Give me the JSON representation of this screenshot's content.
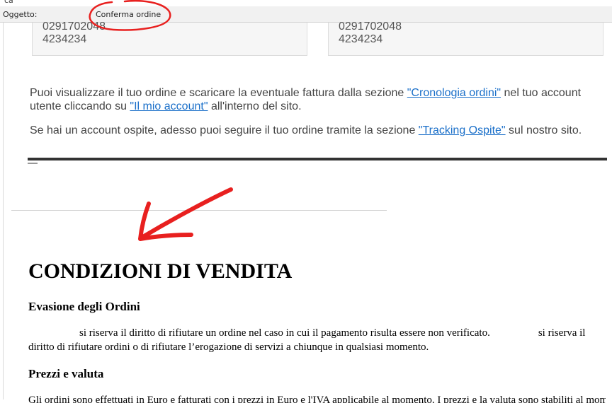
{
  "header": {
    "top_fragment": "ca",
    "subject_label": "Oggetto:",
    "subject_value": "Conferma ordine"
  },
  "addresses": {
    "left": {
      "line1": "0291702048",
      "line2": "4234234"
    },
    "right": {
      "line1": "0291702048",
      "line2": "4234234"
    }
  },
  "info": {
    "p1_pre": "Puoi visualizzare il tuo ordine e scaricare la eventuale fattura dalla sezione ",
    "link_cronologia": "\"Cronologia ordini\"",
    "p1_mid": " nel tuo account utente cliccando su ",
    "link_account": "\"Il mio account\"",
    "p1_post": " all'interno del sito.",
    "p2_pre": "Se hai un account ospite, adesso puoi seguire il tuo ordine tramite la sezione ",
    "link_tracking": "\"Tracking Ospite\"",
    "p2_post": " sul nostro sito."
  },
  "terms": {
    "title": "CONDIZIONI DI VENDITA",
    "evasione_heading": "Evasione degli Ordini",
    "evasione_text_1": "si riserva il diritto di rifiutare un ordine nel caso in cui il pagamento risulta essere non verificato.",
    "evasione_text_2": "si riserva il diritto di rifiutare ordini o di rifiutare l’erogazione di servizi a chiunque in qualsiasi momento.",
    "prezzi_heading": "Prezzi e valuta",
    "prezzi_text": "Gli ordini sono effettuati in Euro e fatturati con i prezzi in Euro e l'IVA applicabile al momento. I prezzi e la valuta sono stabiliti al momento dell'ordine."
  },
  "colors": {
    "link": "#1a6fc9",
    "annotation": "#e8201f",
    "rule": "#333333"
  }
}
